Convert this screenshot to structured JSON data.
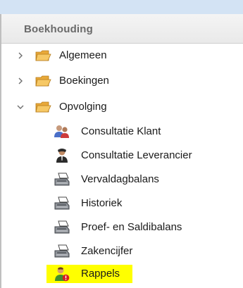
{
  "panel": {
    "title": "Boekhouding"
  },
  "tree": {
    "groups": [
      {
        "label": "Algemeen",
        "expanded": false
      },
      {
        "label": "Boekingen",
        "expanded": false
      },
      {
        "label": "Opvolging",
        "expanded": true
      }
    ],
    "items": [
      {
        "label": "Consultatie Klant",
        "icon": "users-icon"
      },
      {
        "label": "Consultatie Leverancier",
        "icon": "user-icon"
      },
      {
        "label": "Vervaldagbalans",
        "icon": "printer-icon"
      },
      {
        "label": "Historiek",
        "icon": "printer-icon"
      },
      {
        "label": "Proef- en Saldibalans",
        "icon": "printer-icon"
      },
      {
        "label": "Zakencijfer",
        "icon": "printer-icon"
      },
      {
        "label": "Rappels",
        "icon": "user-warning-icon",
        "selected": true
      }
    ]
  },
  "colors": {
    "highlight": "#ffff00",
    "folder": "#f0b64a",
    "topbar": "#d3e3f4"
  }
}
